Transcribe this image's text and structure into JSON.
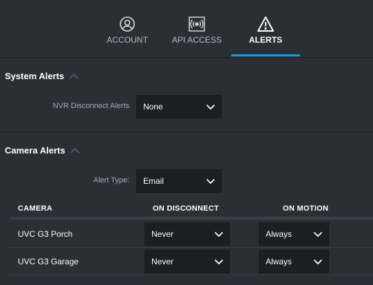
{
  "tabs": [
    {
      "label": "ACCOUNT",
      "icon": "user-circle-icon",
      "active": false
    },
    {
      "label": "API ACCESS",
      "icon": "broadcast-icon",
      "active": false
    },
    {
      "label": "ALERTS",
      "icon": "warning-triangle-icon",
      "active": true
    }
  ],
  "colors": {
    "accent": "#1a9be0",
    "background": "#2b2e35",
    "select_bg": "#1c1e23"
  },
  "system_alerts": {
    "title": "System Alerts",
    "nvr_disconnect": {
      "label": "NVR Disconnect Alerts",
      "value": "None"
    }
  },
  "camera_alerts": {
    "title": "Camera Alerts",
    "alert_type": {
      "label": "Alert Type:",
      "value": "Email"
    },
    "columns": [
      "CAMERA",
      "ON DISCONNECT",
      "ON MOTION"
    ],
    "rows": [
      {
        "camera": "UVC G3 Porch",
        "on_disconnect": "Never",
        "on_motion": "Always"
      },
      {
        "camera": "UVC G3 Garage",
        "on_disconnect": "Never",
        "on_motion": "Always"
      }
    ]
  }
}
